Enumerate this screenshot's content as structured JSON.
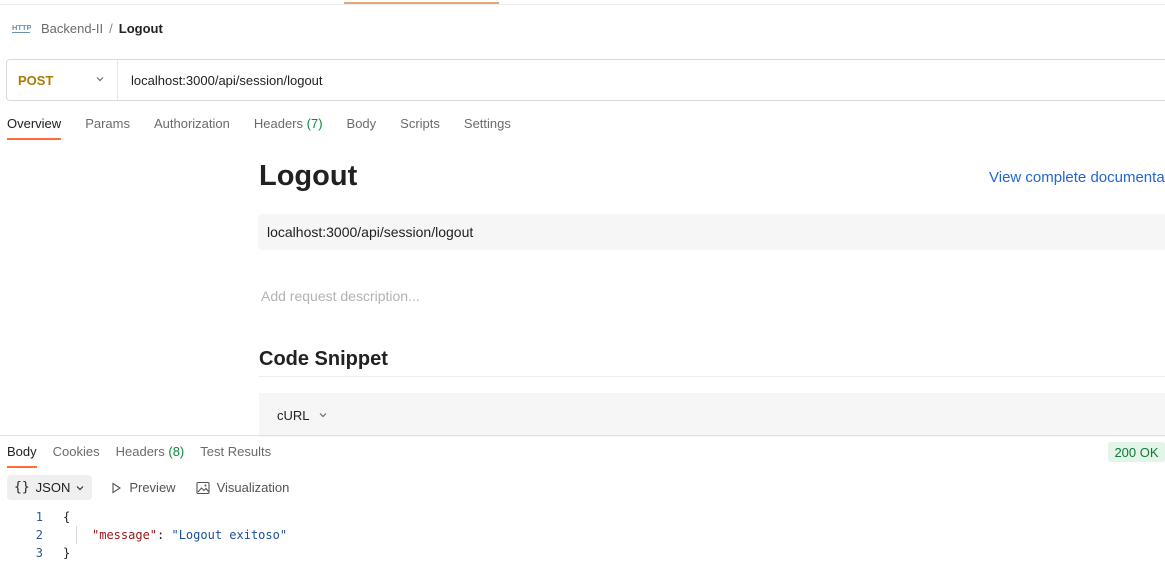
{
  "breadcrumb": {
    "parent": "Backend-II",
    "separator": "/",
    "current": "Logout"
  },
  "request": {
    "method": "POST",
    "url": "localhost:3000/api/session/logout"
  },
  "request_tabs": [
    {
      "label": "Overview",
      "count": ""
    },
    {
      "label": "Params",
      "count": ""
    },
    {
      "label": "Authorization",
      "count": ""
    },
    {
      "label": "Headers",
      "count": "(7)"
    },
    {
      "label": "Body",
      "count": ""
    },
    {
      "label": "Scripts",
      "count": ""
    },
    {
      "label": "Settings",
      "count": ""
    }
  ],
  "docs": {
    "title": "Logout",
    "link": "View complete documentation",
    "url": "localhost:3000/api/session/logout",
    "description_placeholder": "Add request description...",
    "snippet_title": "Code Snippet",
    "snippet_lang": "cURL"
  },
  "response_tabs": [
    {
      "label": "Body",
      "count": ""
    },
    {
      "label": "Cookies",
      "count": ""
    },
    {
      "label": "Headers",
      "count": "(8)"
    },
    {
      "label": "Test Results",
      "count": ""
    }
  ],
  "response": {
    "status": "200 OK",
    "format_braces": "{}",
    "format": "JSON",
    "preview_label": "Preview",
    "visualization_label": "Visualization",
    "lines": [
      {
        "n": "1",
        "text": "{"
      },
      {
        "n": "2",
        "key": "\"message\"",
        "sep": ": ",
        "value": "\"Logout exitoso\""
      },
      {
        "n": "3",
        "text": "}"
      }
    ]
  },
  "colors": {
    "method": "#ad7a03",
    "accent": "#ff6c37",
    "link": "#2166d6",
    "status_ok": "#0b7a3a"
  },
  "icons": [
    "http-icon",
    "chevron-down-icon",
    "play-icon",
    "image-icon"
  ]
}
